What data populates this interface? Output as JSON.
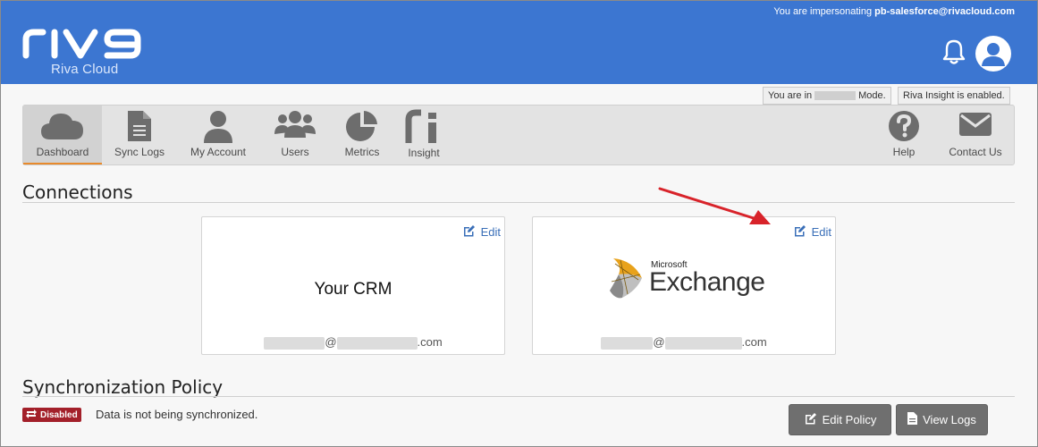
{
  "header": {
    "logo_text": "riva",
    "logo_subtitle": "Riva Cloud",
    "impersonating_prefix": "You are impersonating",
    "impersonating_user": "pb-salesforce@rivacloud.com"
  },
  "mode_badges": {
    "mode_prefix": "You are in",
    "mode_suffix": "Mode.",
    "insight": "Riva Insight is enabled."
  },
  "nav": {
    "items": [
      {
        "label": "Dashboard",
        "icon": "cloud-icon"
      },
      {
        "label": "Sync Logs",
        "icon": "document-icon"
      },
      {
        "label": "My Account",
        "icon": "user-icon"
      },
      {
        "label": "Users",
        "icon": "users-group-icon"
      },
      {
        "label": "Metrics",
        "icon": "pie-chart-icon"
      },
      {
        "label": "Insight",
        "icon": "riva-insight-icon"
      }
    ],
    "right_items": [
      {
        "label": "Help",
        "icon": "help-icon"
      },
      {
        "label": "Contact Us",
        "icon": "envelope-icon"
      }
    ]
  },
  "connections": {
    "title": "Connections",
    "cards": [
      {
        "title": "Your CRM",
        "edit_label": "Edit",
        "email_at": "@",
        "email_tld": ".com"
      },
      {
        "logo_top": "Microsoft",
        "logo_main": "Exchange",
        "edit_label": "Edit",
        "email_at": "@",
        "email_tld": ".com"
      }
    ]
  },
  "policy": {
    "title": "Synchronization Policy",
    "status_badge": "Disabled",
    "status_text": "Data is not being synchronized.",
    "edit_button": "Edit Policy",
    "logs_button": "View Logs"
  },
  "colors": {
    "header_bg": "#3c76d1",
    "active_tab_underline": "#e88a2c",
    "disabled_badge": "#a3202a",
    "link": "#3a6fb8",
    "annotation_arrow": "#d8232a"
  }
}
